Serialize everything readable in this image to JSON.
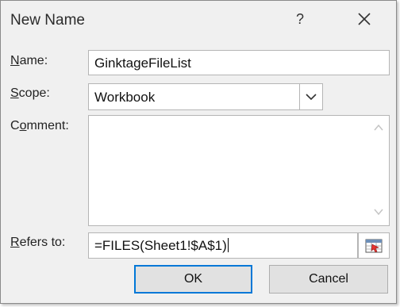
{
  "window": {
    "title": "New Name",
    "help_glyph": "?",
    "close_glyph": "✕"
  },
  "form": {
    "name_label_accel": "N",
    "name_label_rest": "ame:",
    "name_value": "GinktageFileList",
    "scope_label_accel": "S",
    "scope_label_rest": "cope:",
    "scope_value": "Workbook",
    "comment_label_pre": "C",
    "comment_label_accel": "o",
    "comment_label_rest": "mment:",
    "comment_value": "",
    "refers_label_accel": "R",
    "refers_label_rest": "efers to:",
    "refers_value": "=FILES(Sheet1!$A$1)"
  },
  "buttons": {
    "ok_label": "OK",
    "cancel_label": "Cancel"
  },
  "colors": {
    "default_button_border": "#0078d7",
    "collapse_icon_accent": "#e8312f"
  }
}
